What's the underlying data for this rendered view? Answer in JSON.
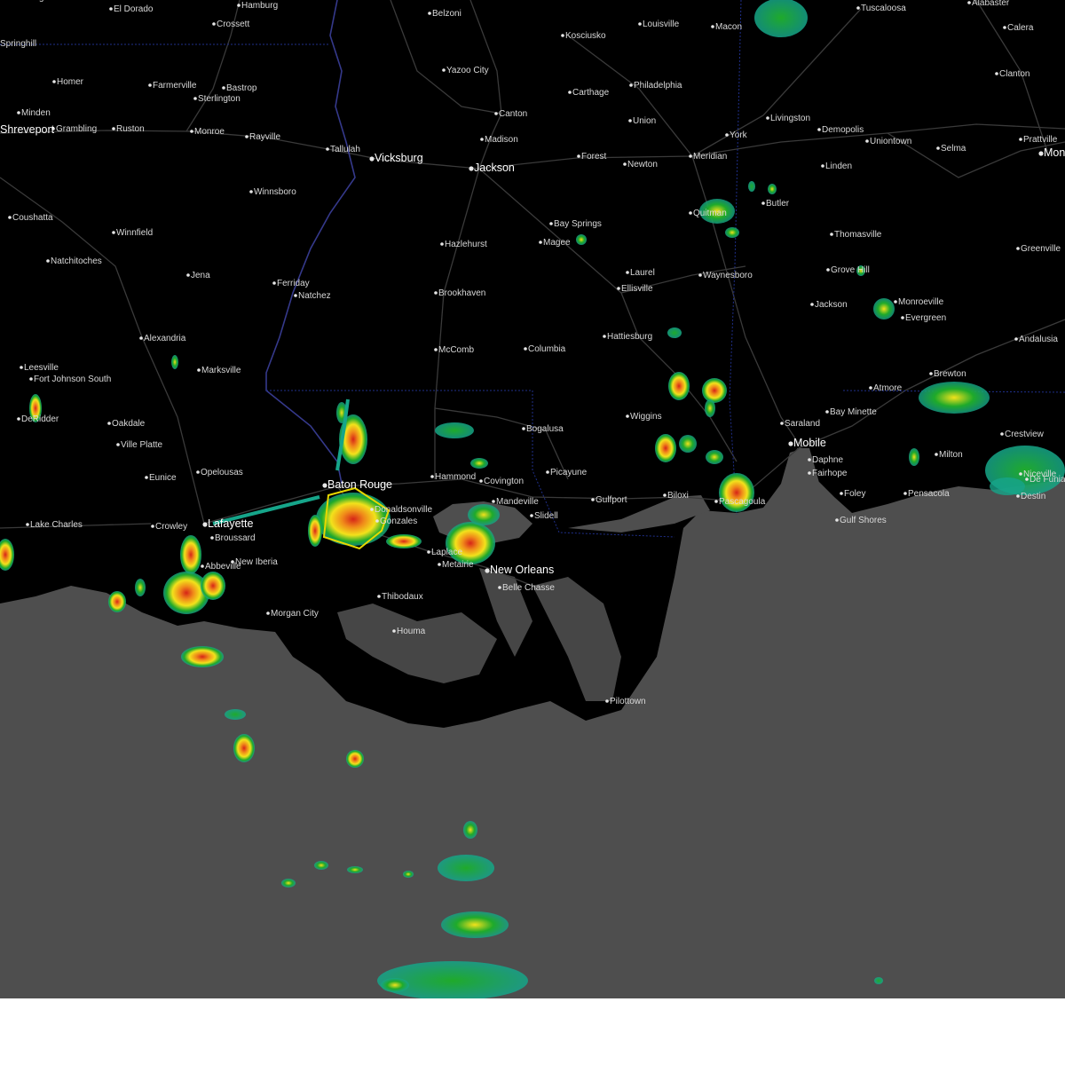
{
  "colors": {
    "land": "#000000",
    "water": "#4e4e4e",
    "roads": "#3a3a3a",
    "state_borders": "#1f2f8a",
    "rivers": "#3b3f9a",
    "warning_polygon": "#e6d800",
    "radar_light": "#16a58a",
    "radar_green": "#1faa2a",
    "radar_yellow": "#f2e21b",
    "radar_orange": "#f08a1a",
    "radar_red": "#d62418",
    "labels": "#d9d9d9",
    "background_below_map": "#ffffff"
  },
  "warning_polygon": {
    "label": ""
  },
  "cities": [
    {
      "name": "Magnolia"
    },
    {
      "name": "El Dorado"
    },
    {
      "name": "Hamburg"
    },
    {
      "name": "Crossett"
    },
    {
      "name": "Belzoni"
    },
    {
      "name": "Louisville"
    },
    {
      "name": "Macon"
    },
    {
      "name": "Tuscaloosa"
    },
    {
      "name": "Alabaster"
    },
    {
      "name": "Calera"
    },
    {
      "name": "Springhill"
    },
    {
      "name": "Kosciusko"
    },
    {
      "name": "Yazoo City"
    },
    {
      "name": "Homer"
    },
    {
      "name": "Farmerville"
    },
    {
      "name": "Bastrop"
    },
    {
      "name": "Sterlington"
    },
    {
      "name": "Carthage"
    },
    {
      "name": "Philadelphia"
    },
    {
      "name": "Clanton"
    },
    {
      "name": "Minden"
    },
    {
      "name": "Canton"
    },
    {
      "name": "Union"
    },
    {
      "name": "Livingston"
    },
    {
      "name": "Grambling"
    },
    {
      "name": "Ruston"
    },
    {
      "name": "Monroe"
    },
    {
      "name": "Rayville"
    },
    {
      "name": "Demopolis"
    },
    {
      "name": "Madison"
    },
    {
      "name": "York"
    },
    {
      "name": "Uniontown"
    },
    {
      "name": "Prattville"
    },
    {
      "name": "Tallulah"
    },
    {
      "name": "Vicksburg"
    },
    {
      "name": "Jackson"
    },
    {
      "name": "Forest"
    },
    {
      "name": "Newton"
    },
    {
      "name": "Meridian"
    },
    {
      "name": "Selma"
    },
    {
      "name": "Linden"
    },
    {
      "name": "Winnsboro"
    },
    {
      "name": "Quitman"
    },
    {
      "name": "Butler"
    },
    {
      "name": "Coushatta"
    },
    {
      "name": "Bay Springs"
    },
    {
      "name": "Winnfield"
    },
    {
      "name": "Magee"
    },
    {
      "name": "Hazlehurst"
    },
    {
      "name": "Thomasville"
    },
    {
      "name": "Greenville"
    },
    {
      "name": "Natchitoches"
    },
    {
      "name": "Laurel"
    },
    {
      "name": "Grove Hill"
    },
    {
      "name": "Jena"
    },
    {
      "name": "Waynesboro"
    },
    {
      "name": "Ferriday"
    },
    {
      "name": "Ellisville"
    },
    {
      "name": "Brookhaven"
    },
    {
      "name": "Natchez"
    },
    {
      "name": "Jackson"
    },
    {
      "name": "Monroeville"
    },
    {
      "name": "Evergreen"
    },
    {
      "name": "Alexandria"
    },
    {
      "name": "Hattiesburg"
    },
    {
      "name": "Andalusia"
    },
    {
      "name": "McComb"
    },
    {
      "name": "Columbia"
    },
    {
      "name": "Marksville"
    },
    {
      "name": "Leesville"
    },
    {
      "name": "Fort Johnson South"
    },
    {
      "name": "Atmore"
    },
    {
      "name": "Brewton"
    },
    {
      "name": "DeRidder"
    },
    {
      "name": "Oakdale"
    },
    {
      "name": "Wiggins"
    },
    {
      "name": "Saraland"
    },
    {
      "name": "Bay Minette"
    },
    {
      "name": "Bogalusa"
    },
    {
      "name": "Ville Platte"
    },
    {
      "name": "Crestview"
    },
    {
      "name": "Mobile"
    },
    {
      "name": "Milton"
    },
    {
      "name": "Daphne"
    },
    {
      "name": "Fairhope"
    },
    {
      "name": "Opelousas"
    },
    {
      "name": "Picayune"
    },
    {
      "name": "Hammond"
    },
    {
      "name": "Eunice"
    },
    {
      "name": "Covington"
    },
    {
      "name": "Baton Rouge"
    },
    {
      "name": "Foley"
    },
    {
      "name": "Pensacola"
    },
    {
      "name": "Niceville"
    },
    {
      "name": "Destin"
    },
    {
      "name": "Mandeville"
    },
    {
      "name": "Gulfport"
    },
    {
      "name": "Biloxi"
    },
    {
      "name": "Pascagoula"
    },
    {
      "name": "Slidell"
    },
    {
      "name": "Lake Charles"
    },
    {
      "name": "Crowley"
    },
    {
      "name": "Lafayette"
    },
    {
      "name": "Gulf Shores"
    },
    {
      "name": "Broussard"
    },
    {
      "name": "Laplace"
    },
    {
      "name": "Abbeville"
    },
    {
      "name": "New Iberia"
    },
    {
      "name": "Metairie"
    },
    {
      "name": "New Orleans"
    },
    {
      "name": "Belle Chasse"
    },
    {
      "name": "Thibodaux"
    },
    {
      "name": "Morgan City"
    },
    {
      "name": "Houma"
    },
    {
      "name": "Pilottown"
    },
    {
      "name": "Donaldsonville"
    },
    {
      "name": "Gonzales"
    },
    {
      "name": "Shreveport"
    },
    {
      "name": "Montgomery"
    },
    {
      "name": "De Funiak"
    }
  ]
}
